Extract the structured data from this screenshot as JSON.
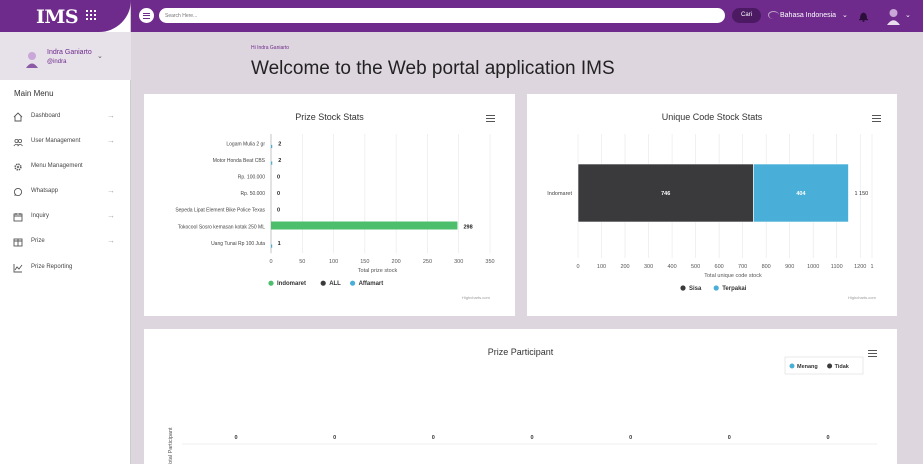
{
  "app": {
    "logo": "IMS"
  },
  "user": {
    "name": "Indra Ganiarto",
    "handle": "@indra"
  },
  "sidebar": {
    "menu_title": "Main Menu",
    "items": [
      {
        "label": "Dashboard",
        "icon": "home-icon",
        "arrow": true
      },
      {
        "label": "User Management",
        "icon": "users-icon",
        "arrow": true
      },
      {
        "label": "Menu Management",
        "icon": "gear-icon",
        "arrow": false
      },
      {
        "label": "Whatsapp",
        "icon": "whatsapp-icon",
        "arrow": true
      },
      {
        "label": "Inquiry",
        "icon": "calendar-icon",
        "arrow": true
      },
      {
        "label": "Prize",
        "icon": "gift-icon",
        "arrow": true
      },
      {
        "label": "Prize Reporting",
        "icon": "chart-icon",
        "arrow": false
      }
    ]
  },
  "topbar": {
    "search_placeholder": "Search Here...",
    "search_button": "Cari",
    "language": "Bahasa Indonesia"
  },
  "page": {
    "breadcrumb": "Hi Indra Ganiarto",
    "title": "Welcome to the Web portal application IMS"
  },
  "colors": {
    "primary": "#6f2b8c",
    "green": "#4cbe6c",
    "dark": "#3a3a3d",
    "blue": "#4aafd8"
  },
  "credits": "Highcharts.com",
  "chart_data": [
    {
      "type": "bar",
      "title": "Prize Stock Stats",
      "categories": [
        "Logam Mulia 2 gr",
        "Motor Honda Beat CBS",
        "Rp. 100.000",
        "Rp. 50.000",
        "Sepeda Lipat Element Bike Police Texas",
        "Tokocool Sosro kemasan kotak 250 ML",
        "Uang Tunai Rp 100 Juta"
      ],
      "series": [
        {
          "name": "Indomaret",
          "color": "#4cbe6c",
          "values": [
            0,
            0,
            0,
            0,
            0,
            298,
            0
          ]
        },
        {
          "name": "ALL",
          "color": "#3a3a3d",
          "values": [
            0,
            0,
            0,
            0,
            0,
            0,
            0
          ]
        },
        {
          "name": "Affamart",
          "color": "#4aafd8",
          "values": [
            2,
            2,
            0,
            0,
            0,
            0,
            1
          ]
        }
      ],
      "totals": [
        "2",
        "2",
        "0",
        "0",
        "0",
        "298",
        "1"
      ],
      "xlabel": "Total prize stock",
      "xticks": [
        "0",
        "50",
        "100",
        "150",
        "200",
        "250",
        "300",
        "350"
      ],
      "xlim": [
        0,
        350
      ],
      "legend": "bottom"
    },
    {
      "type": "bar",
      "stacked": true,
      "title": "Unique Code Stock Stats",
      "categories": [
        "Indomaret"
      ],
      "series": [
        {
          "name": "Sisa",
          "color": "#3a3a3d",
          "values": [
            746
          ]
        },
        {
          "name": "Terpakai",
          "color": "#4aafd8",
          "values": [
            404
          ]
        }
      ],
      "segment_labels": [
        "746",
        "404"
      ],
      "total_label": "1 150",
      "xlabel": "Total unique code stock",
      "xticks": [
        "0",
        "100",
        "200",
        "300",
        "400",
        "500",
        "600",
        "700",
        "800",
        "900",
        "1000",
        "1100",
        "1200",
        "1"
      ],
      "xlim": [
        0,
        1250
      ],
      "legend": "bottom"
    },
    {
      "type": "line",
      "title": "Prize Participant",
      "ylabel": "Total Participant",
      "series": [
        {
          "name": "Menang",
          "color": "#4aafd8"
        },
        {
          "name": "Tidak",
          "color": "#3a3a3d"
        }
      ],
      "point_labels": [
        "0",
        "0",
        "0",
        "0",
        "0",
        "0",
        "0"
      ],
      "legend": "top-right"
    }
  ]
}
